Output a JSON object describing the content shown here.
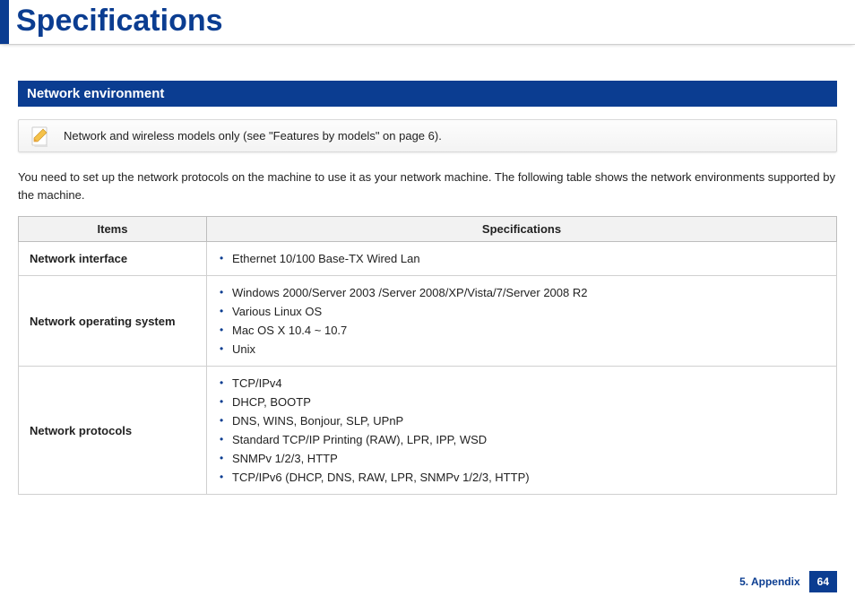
{
  "title": "Specifications",
  "section_header": "Network environment",
  "note": "Network and wireless models only (see \"Features by models\" on page 6).",
  "intro": "You need to set up the network protocols on the machine to use it as your network machine. The following table shows the network environments supported by the machine.",
  "table": {
    "headers": {
      "items": "Items",
      "specs": "Specifications"
    },
    "rows": [
      {
        "item": "Network interface",
        "specs": [
          "Ethernet 10/100 Base-TX Wired Lan"
        ]
      },
      {
        "item": "Network operating system",
        "specs": [
          "Windows 2000/Server 2003 /Server 2008/XP/Vista/7/Server 2008 R2",
          "Various Linux OS",
          "Mac OS X 10.4 ~ 10.7",
          "Unix"
        ]
      },
      {
        "item": "Network protocols",
        "specs": [
          "TCP/IPv4",
          "DHCP, BOOTP",
          "DNS, WINS, Bonjour, SLP, UPnP",
          "Standard TCP/IP Printing (RAW), LPR, IPP, WSD",
          "SNMPv 1/2/3, HTTP",
          "TCP/IPv6 (DHCP, DNS, RAW, LPR, SNMPv 1/2/3, HTTP)"
        ]
      }
    ]
  },
  "footer": {
    "section": "5. Appendix",
    "page": "64"
  }
}
